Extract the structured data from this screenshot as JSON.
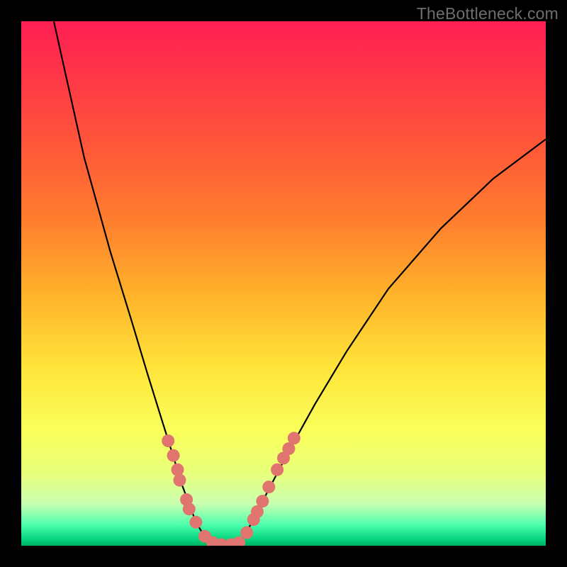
{
  "watermark": "TheBottleneck.com",
  "colors": {
    "frame": "#000000",
    "curve": "#000000",
    "marker_fill": "#e0746e",
    "marker_stroke": "#d45f5a"
  },
  "chart_data": {
    "type": "line",
    "title": "",
    "xlabel": "",
    "ylabel": "",
    "xlim": [
      0,
      100
    ],
    "ylim": [
      0,
      100
    ],
    "note": "No axis ticks or numeric labels are rendered; both curve coordinates and marker coordinates are estimated pixel-fractions of the 740x740 plot area (x rightward, y downward).",
    "series": [
      {
        "name": "bottleneck-curve-left",
        "x": [
          0.062,
          0.12,
          0.17,
          0.21,
          0.24,
          0.268,
          0.29,
          0.305,
          0.32,
          0.333,
          0.345,
          0.36
        ],
        "y": [
          0.0,
          0.26,
          0.44,
          0.57,
          0.67,
          0.76,
          0.83,
          0.88,
          0.92,
          0.955,
          0.975,
          0.99
        ]
      },
      {
        "name": "bottleneck-curve-bottom",
        "x": [
          0.36,
          0.38,
          0.4,
          0.42
        ],
        "y": [
          0.99,
          0.997,
          0.997,
          0.99
        ]
      },
      {
        "name": "bottleneck-curve-right",
        "x": [
          0.42,
          0.44,
          0.468,
          0.51,
          0.56,
          0.62,
          0.7,
          0.8,
          0.9,
          1.0
        ],
        "y": [
          0.99,
          0.955,
          0.9,
          0.82,
          0.73,
          0.63,
          0.51,
          0.395,
          0.3,
          0.225
        ]
      }
    ],
    "markers": [
      {
        "x": 0.28,
        "y": 0.8
      },
      {
        "x": 0.29,
        "y": 0.828
      },
      {
        "x": 0.298,
        "y": 0.855
      },
      {
        "x": 0.302,
        "y": 0.875
      },
      {
        "x": 0.315,
        "y": 0.912
      },
      {
        "x": 0.32,
        "y": 0.93
      },
      {
        "x": 0.333,
        "y": 0.955
      },
      {
        "x": 0.35,
        "y": 0.982
      },
      {
        "x": 0.365,
        "y": 0.994
      },
      {
        "x": 0.382,
        "y": 0.998
      },
      {
        "x": 0.4,
        "y": 0.998
      },
      {
        "x": 0.415,
        "y": 0.994
      },
      {
        "x": 0.43,
        "y": 0.975
      },
      {
        "x": 0.443,
        "y": 0.95
      },
      {
        "x": 0.45,
        "y": 0.935
      },
      {
        "x": 0.46,
        "y": 0.915
      },
      {
        "x": 0.472,
        "y": 0.888
      },
      {
        "x": 0.488,
        "y": 0.855
      },
      {
        "x": 0.5,
        "y": 0.833
      },
      {
        "x": 0.51,
        "y": 0.815
      },
      {
        "x": 0.52,
        "y": 0.795
      }
    ]
  }
}
